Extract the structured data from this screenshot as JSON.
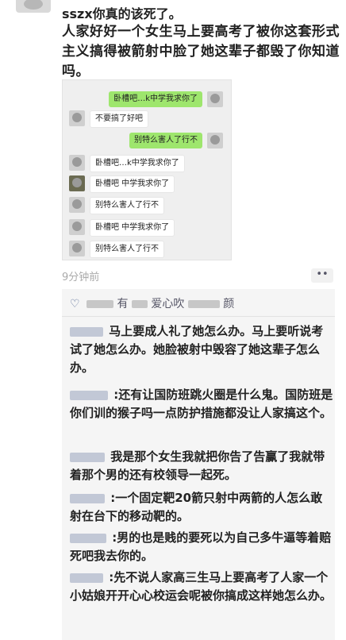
{
  "post": {
    "handle": "sszx你真的该死了。",
    "text": "人家好好一个女生马上要高考了被你这套形式主义搞得被箭射中脸了她这辈子都毁了你知道吗。",
    "time": "9分钟前",
    "more": "••"
  },
  "screenshot_chat": [
    {
      "side": "right",
      "text": "卧槽吧…k中学我求你了"
    },
    {
      "side": "left",
      "text": "不要搞了好吧"
    },
    {
      "side": "right",
      "text": "别特么害人了行不"
    },
    {
      "side": "left",
      "text": "卧槽吧…k中学我求你了"
    },
    {
      "side": "left",
      "text": "卧槽吧  中学我求你了"
    },
    {
      "side": "left",
      "text": "别特么害人了行不"
    },
    {
      "side": "left",
      "text": "卧槽吧  中学我求你了"
    },
    {
      "side": "left",
      "text": "别特么害人了行不"
    }
  ],
  "likes": {
    "icon": "heart-icon",
    "name_fragments": [
      "有",
      "爱心吹",
      "颜"
    ]
  },
  "comments": [
    {
      "text": "马上要成人礼了她怎么办。马上要听说考试了她怎么办。她脸被射中毁容了她这辈子怎么办。"
    },
    {
      "text": ":还有让国防班跳火圈是什么鬼。国防班是你们训的猴子吗一点防护措施都没让人家搞这个。"
    },
    {
      "text": "我是那个女生我就把你告了告赢了我就带着那个男的还有校领导一起死。"
    },
    {
      "text": ":一个固定靶20箭只射中两箭的人怎么敢射在台下的移动靶的。"
    },
    {
      "text": ":男的也是贱的要死以为自己多牛逼等着赔死吧我去你的。"
    },
    {
      "text": ":先不说人家高三生马上要高考了人家一个小姑娘开开心心校运会呢被你搞成这样她怎么办。"
    }
  ]
}
